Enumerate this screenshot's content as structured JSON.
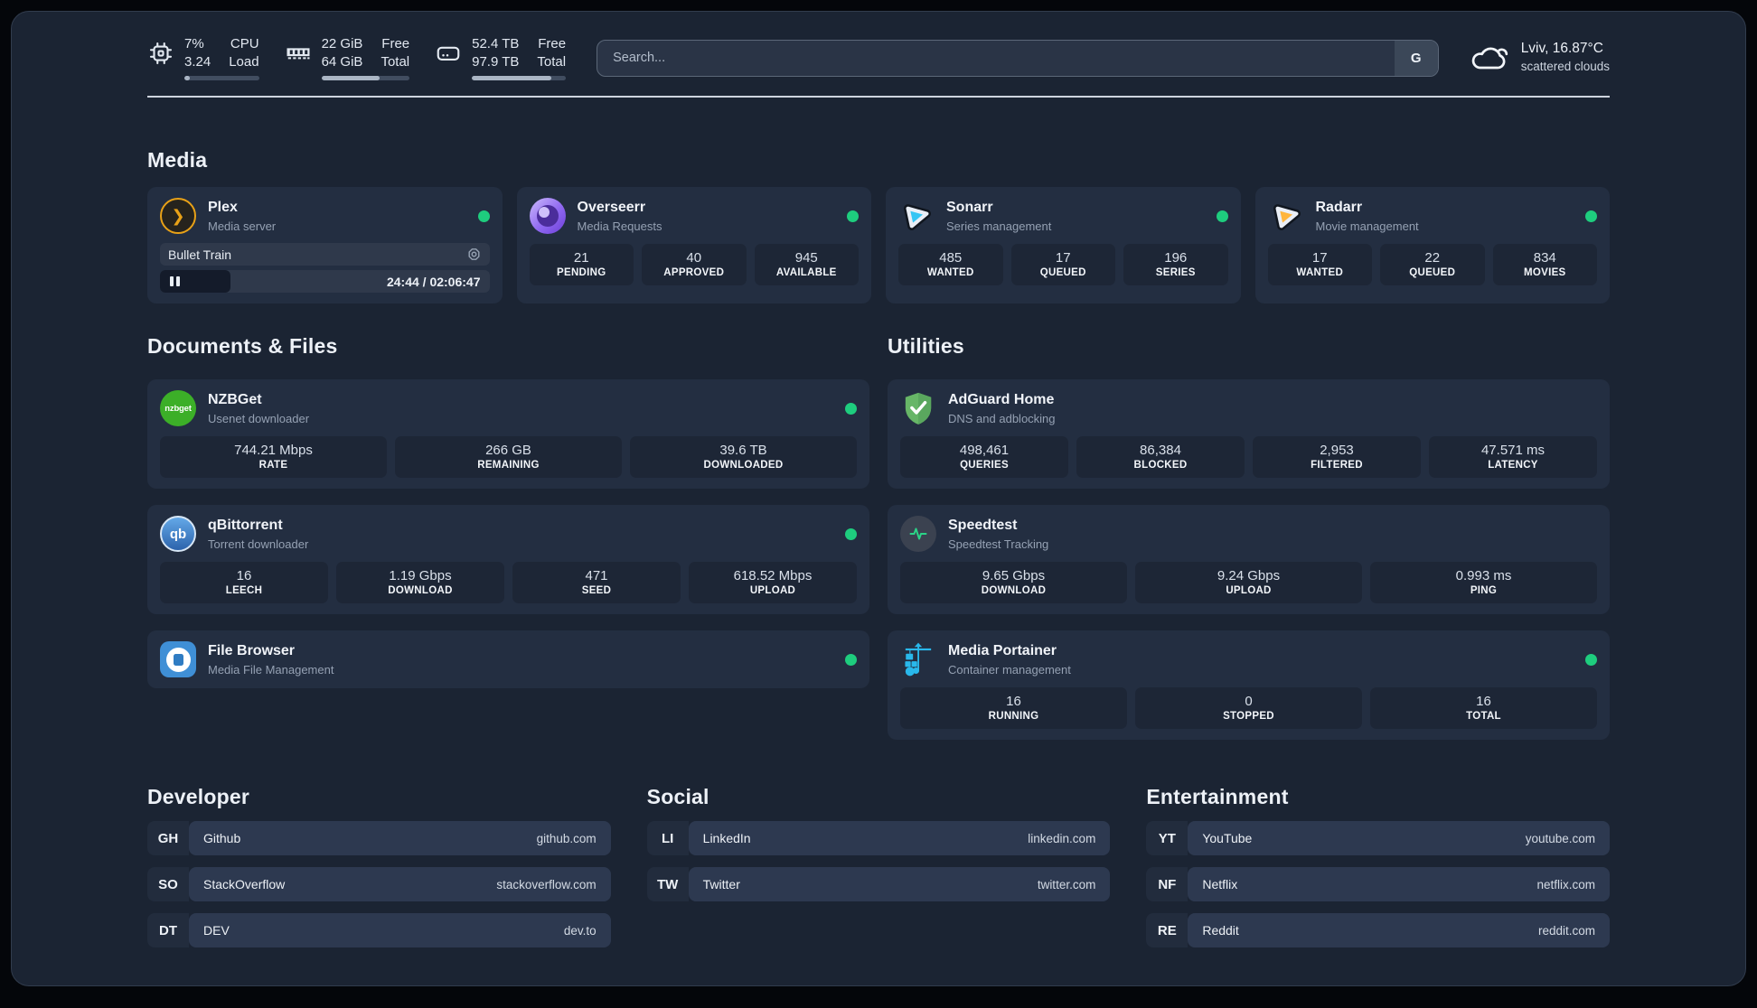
{
  "topbar": {
    "cpu": {
      "v1": "7%",
      "v2": "3.24",
      "l1": "CPU",
      "l2": "Load",
      "progress_pct": 7
    },
    "memory": {
      "v1": "22 GiB",
      "v2": "64 GiB",
      "l1": "Free",
      "l2": "Total",
      "progress_pct": 66
    },
    "disk": {
      "v1": "52.4 TB",
      "v2": "97.9 TB",
      "l1": "Free",
      "l2": "Total",
      "progress_pct": 85
    },
    "search": {
      "placeholder": "Search...",
      "button_label": "G"
    },
    "weather": {
      "line1": "Lviv, 16.87°C",
      "line2": "scattered clouds"
    }
  },
  "sections": {
    "media": {
      "title": "Media",
      "plex": {
        "name": "Plex",
        "desc": "Media server",
        "status": "online",
        "player": {
          "title": "Bullet Train",
          "time": "24:44 / 02:06:47"
        }
      },
      "overseerr": {
        "name": "Overseerr",
        "desc": "Media Requests",
        "status": "online",
        "stats": [
          {
            "value": "21",
            "label": "PENDING"
          },
          {
            "value": "40",
            "label": "APPROVED"
          },
          {
            "value": "945",
            "label": "AVAILABLE"
          }
        ]
      },
      "sonarr": {
        "name": "Sonarr",
        "desc": "Series management",
        "status": "online",
        "stats": [
          {
            "value": "485",
            "label": "WANTED"
          },
          {
            "value": "17",
            "label": "QUEUED"
          },
          {
            "value": "196",
            "label": "SERIES"
          }
        ]
      },
      "radarr": {
        "name": "Radarr",
        "desc": "Movie management",
        "status": "online",
        "stats": [
          {
            "value": "17",
            "label": "WANTED"
          },
          {
            "value": "22",
            "label": "QUEUED"
          },
          {
            "value": "834",
            "label": "MOVIES"
          }
        ]
      }
    },
    "documents": {
      "title": "Documents & Files",
      "nzbget": {
        "name": "NZBGet",
        "desc": "Usenet downloader",
        "status": "online",
        "icon_text": "nzbget",
        "stats": [
          {
            "value": "744.21 Mbps",
            "label": "RATE"
          },
          {
            "value": "266 GB",
            "label": "REMAINING"
          },
          {
            "value": "39.6 TB",
            "label": "DOWNLOADED"
          }
        ]
      },
      "qbittorrent": {
        "name": "qBittorrent",
        "desc": "Torrent downloader",
        "status": "online",
        "icon_text": "qb",
        "stats": [
          {
            "value": "16",
            "label": "LEECH"
          },
          {
            "value": "1.19 Gbps",
            "label": "DOWNLOAD"
          },
          {
            "value": "471",
            "label": "SEED"
          },
          {
            "value": "618.52 Mbps",
            "label": "UPLOAD"
          }
        ]
      },
      "filebrowser": {
        "name": "File Browser",
        "desc": "Media File Management",
        "status": "online"
      }
    },
    "utilities": {
      "title": "Utilities",
      "adguard": {
        "name": "AdGuard Home",
        "desc": "DNS and adblocking",
        "stats": [
          {
            "value": "498,461",
            "label": "QUERIES"
          },
          {
            "value": "86,384",
            "label": "BLOCKED"
          },
          {
            "value": "2,953",
            "label": "FILTERED"
          },
          {
            "value": "47.571 ms",
            "label": "LATENCY"
          }
        ]
      },
      "speedtest": {
        "name": "Speedtest",
        "desc": "Speedtest Tracking",
        "stats": [
          {
            "value": "9.65 Gbps",
            "label": "DOWNLOAD"
          },
          {
            "value": "9.24 Gbps",
            "label": "UPLOAD"
          },
          {
            "value": "0.993 ms",
            "label": "PING"
          }
        ]
      },
      "portainer": {
        "name": "Media Portainer",
        "desc": "Container management",
        "status": "online",
        "stats": [
          {
            "value": "16",
            "label": "RUNNING"
          },
          {
            "value": "0",
            "label": "STOPPED"
          },
          {
            "value": "16",
            "label": "TOTAL"
          }
        ]
      }
    },
    "bookmarks": [
      {
        "title": "Developer",
        "items": [
          {
            "abbr": "GH",
            "name": "Github",
            "url": "github.com"
          },
          {
            "abbr": "SO",
            "name": "StackOverflow",
            "url": "stackoverflow.com"
          },
          {
            "abbr": "DT",
            "name": "DEV",
            "url": "dev.to"
          }
        ]
      },
      {
        "title": "Social",
        "items": [
          {
            "abbr": "LI",
            "name": "LinkedIn",
            "url": "linkedin.com"
          },
          {
            "abbr": "TW",
            "name": "Twitter",
            "url": "twitter.com"
          }
        ]
      },
      {
        "title": "Entertainment",
        "items": [
          {
            "abbr": "YT",
            "name": "YouTube",
            "url": "youtube.com"
          },
          {
            "abbr": "NF",
            "name": "Netflix",
            "url": "netflix.com"
          },
          {
            "abbr": "RE",
            "name": "Reddit",
            "url": "reddit.com"
          }
        ]
      }
    ]
  },
  "colors": {
    "status_online": "#1ecd7e",
    "plex": "#e8a117",
    "sonarr": "#35c5f4",
    "radarr": "#ffb53c",
    "nzbget": "#3caf28",
    "qbittorrent": "#3a77c2",
    "adguard": "#67b667",
    "filebrowser": "#3f8fd6",
    "portainer": "#29b8eb",
    "speedtest_pulse": "#2bd487"
  }
}
